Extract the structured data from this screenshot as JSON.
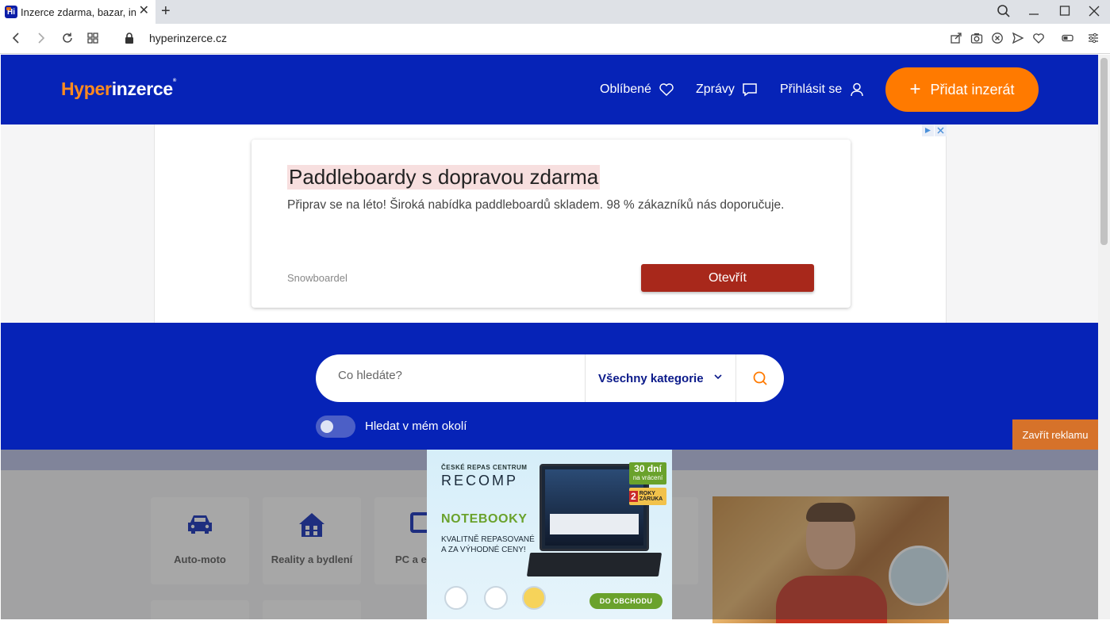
{
  "browser": {
    "tab_title": "Inzerce zdarma, bazar, in",
    "url": "hyperinzerce.cz"
  },
  "header": {
    "logo_part1": "Hyper",
    "logo_part2": "inzerce",
    "nav_favorites": "Oblíbené",
    "nav_messages": "Zprávy",
    "nav_login": "Přihlásit se",
    "add_button": "Přidat inzerát"
  },
  "ad": {
    "title": "Paddleboardy s dopravou zdarma",
    "description": "Připrav se na léto! Široká nabídka paddleboardů skladem. 98 % zákazníků nás doporučuje.",
    "brand": "Snowboardel",
    "cta": "Otevřít"
  },
  "search": {
    "placeholder": "Co hledáte?",
    "category": "Všechny kategorie",
    "nearby_label": "Hledat v mém okolí"
  },
  "categories": [
    {
      "label": "Auto-moto"
    },
    {
      "label": "Reality a bydlení"
    },
    {
      "label": "PC a el"
    }
  ],
  "close_ad": "Zavřít reklamu",
  "banner": {
    "top": "ČESKÉ REPAS CENTRUM",
    "logo": "RECOMP",
    "heading": "NOTEBOOKY",
    "sub": "KVALITNĚ REPASOVANÉ A ZA VÝHODNÉ CENY!",
    "badge_days": "30 dní",
    "badge_days_sub": "na vrácení",
    "badge_warranty_num": "2",
    "badge_warranty": "ROKY ZÁRUKA",
    "shop": "DO OBCHODU"
  },
  "colors": {
    "brand_blue": "#0623b7",
    "brand_orange": "#ff7a00",
    "ad_button": "#a8281b"
  }
}
